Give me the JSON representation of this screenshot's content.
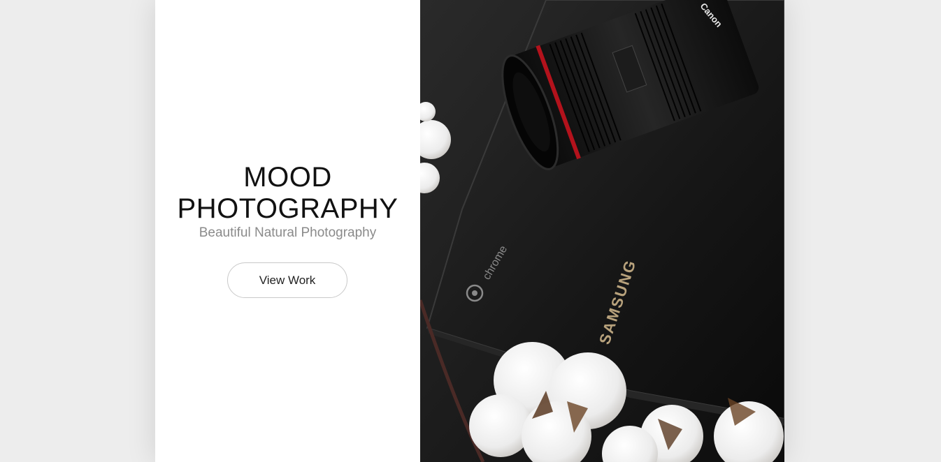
{
  "hero": {
    "title_line1": "MOOD",
    "title_line2": "PHOTOGRAPHY",
    "subtitle": "Beautiful Natural Photography",
    "cta_label": "View Work"
  },
  "photo": {
    "description_icons": [
      "camera-lens",
      "laptop",
      "cotton-flowers"
    ],
    "laptop_logo_text": "chrome",
    "laptop_brand_text": "SAMSUNG",
    "lens_brand_text": "Canon"
  },
  "colors": {
    "background": "#ededed",
    "panel": "#ffffff",
    "title": "#111111",
    "subtitle": "#8a8a8a",
    "button_border": "#c9c9c9"
  }
}
